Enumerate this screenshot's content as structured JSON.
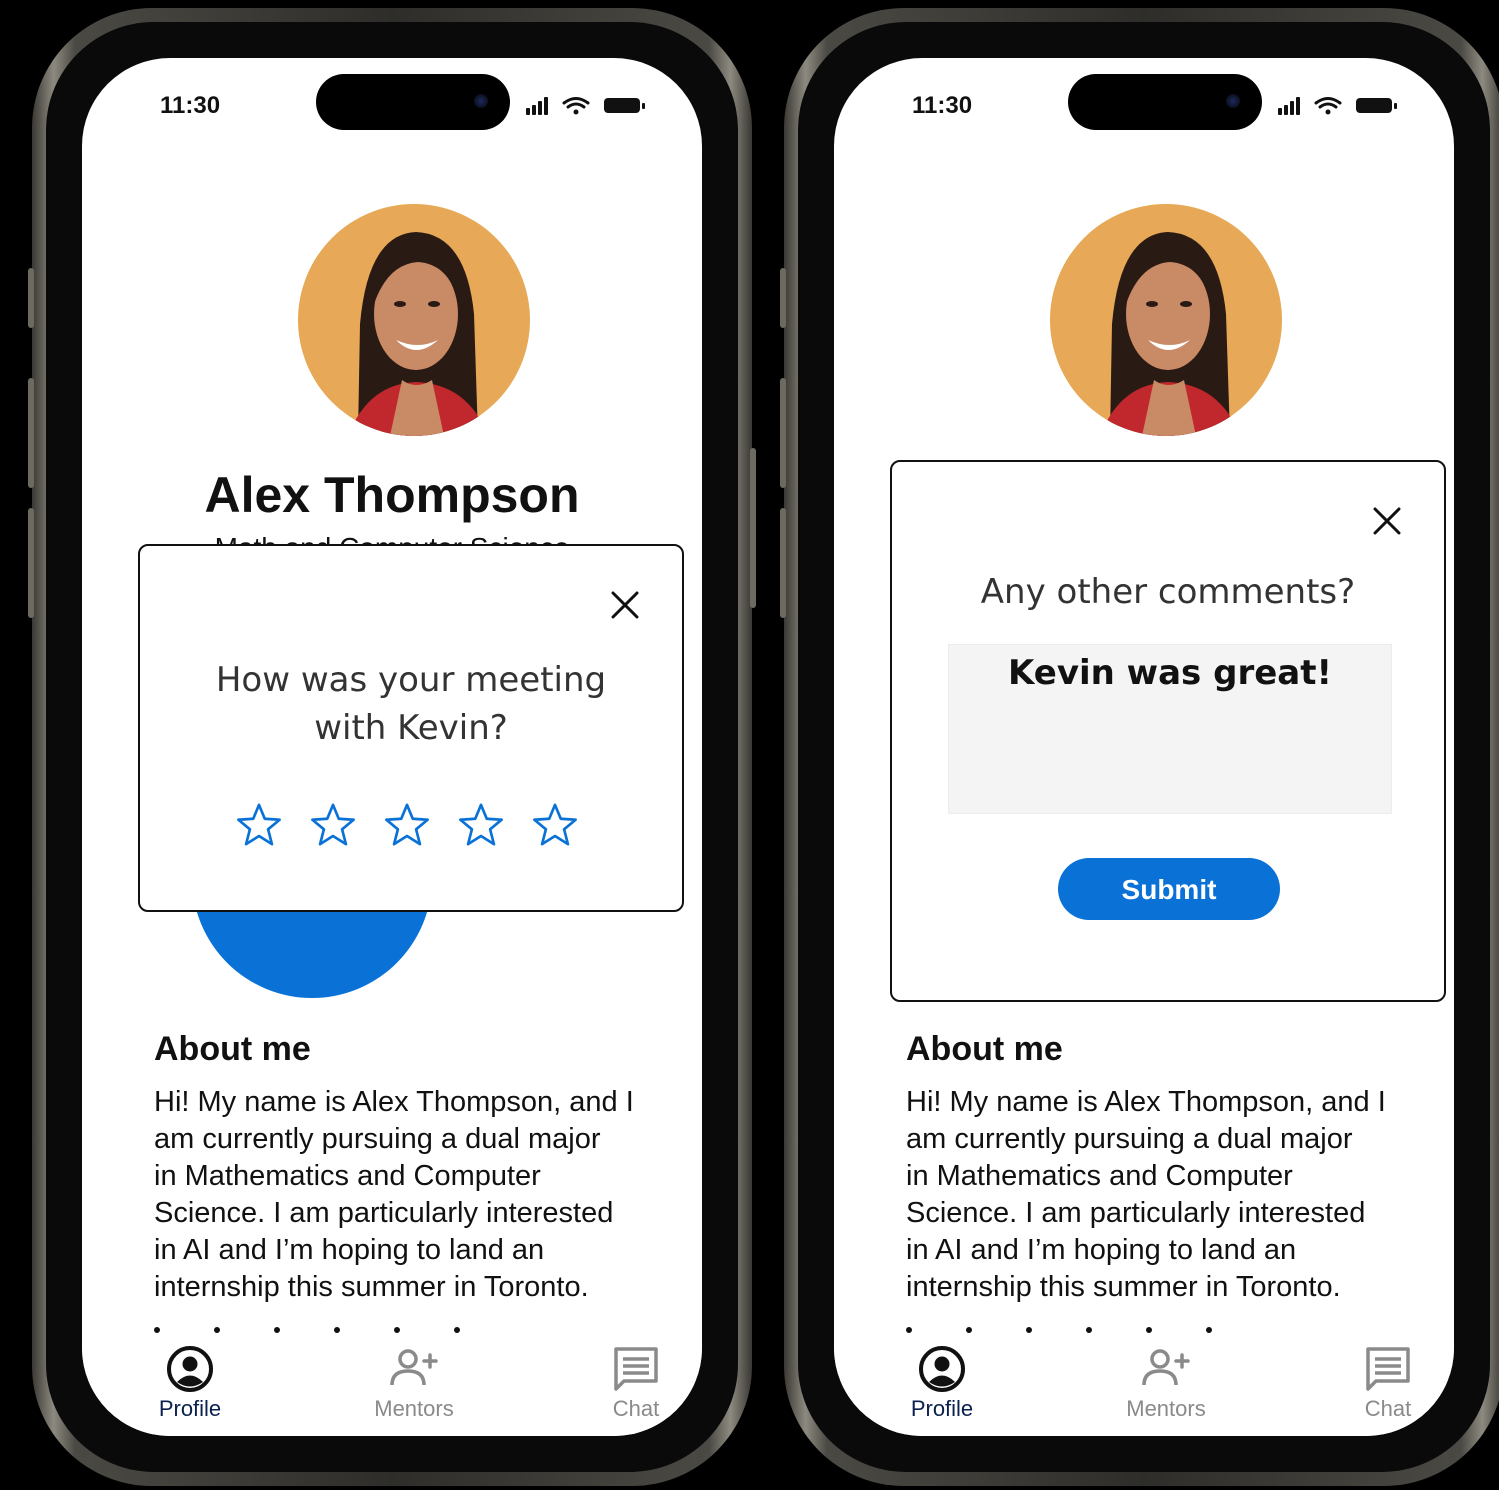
{
  "status_time": "11:30",
  "profile": {
    "name": "Alex Thompson",
    "major": "Math and Computer Science"
  },
  "rating_modal": {
    "question_line1": "How was your meeting",
    "question_line2": "with Kevin?",
    "star_count": 5,
    "rating": 0
  },
  "comments_modal": {
    "question": "Any other comments?",
    "comment_value": "Kevin was great!",
    "submit_label": "Submit"
  },
  "about": {
    "title": "About me",
    "lines": [
      "Hi! My name is Alex Thompson, and I",
      "am currently pursuing a dual major",
      "in Mathematics and Computer",
      "Science. I am particularly interested",
      "in AI and I’m hoping to land an",
      "internship this summer in Toronto."
    ]
  },
  "tabs": [
    {
      "label": "Profile",
      "icon": "profile-icon",
      "active": true
    },
    {
      "label": "Mentors",
      "icon": "add-user-icon",
      "active": false
    },
    {
      "label": "Chat",
      "icon": "chat-icon",
      "active": false
    }
  ],
  "colors": {
    "accent": "#0a72d6",
    "avatar_bg": "#e7a957",
    "star_stroke": "#0a72d6"
  }
}
